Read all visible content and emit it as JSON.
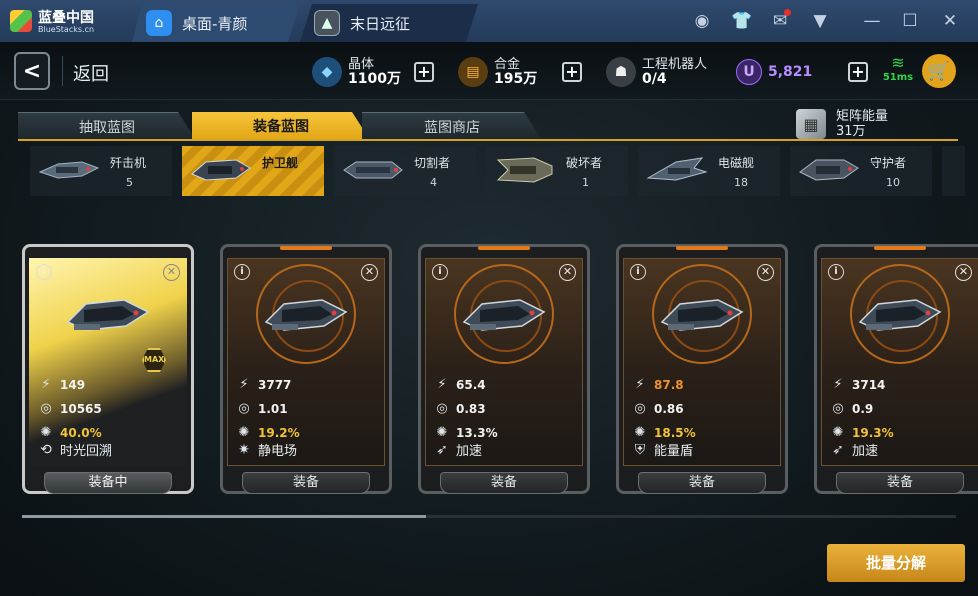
{
  "titlebar": {
    "brand": "蓝叠中国",
    "brand_sub": "BlueStacks.cn",
    "tabs": [
      {
        "label": "桌面-青颜",
        "icon": "home-icon"
      },
      {
        "label": "末日远征",
        "icon": "game-icon"
      }
    ],
    "controls": [
      "account-icon",
      "tshirt-icon",
      "mail-icon",
      "menu-icon",
      "minimize-icon",
      "maximize-icon",
      "close-icon"
    ]
  },
  "topbar": {
    "back_label": "返回",
    "resources": [
      {
        "name": "晶体",
        "value": "1100万",
        "icon": "crystal-icon",
        "color": "#2f8fe0"
      },
      {
        "name": "合金",
        "value": "195万",
        "icon": "alloy-icon",
        "color": "#e59a17"
      },
      {
        "name": "工程机器人",
        "value": "0/4",
        "icon": "robot-icon",
        "color": "#dcdcdc"
      }
    ],
    "u_currency": {
      "symbol": "U",
      "value": "5,821",
      "color": "#9b6bff"
    },
    "ping": "51ms"
  },
  "category_tabs": [
    {
      "label": "抽取蓝图",
      "active": false
    },
    {
      "label": "装备蓝图",
      "active": true
    },
    {
      "label": "蓝图商店",
      "active": false
    }
  ],
  "matrix_energy": {
    "label": "矩阵能量",
    "value": "31万"
  },
  "ship_types": [
    {
      "name": "歼击机",
      "count": "5",
      "active": false
    },
    {
      "name": "护卫舰",
      "count": "",
      "active": true
    },
    {
      "name": "切割者",
      "count": "4",
      "active": false
    },
    {
      "name": "破坏者",
      "count": "1",
      "active": false
    },
    {
      "name": "电磁舰",
      "count": "18",
      "active": false
    },
    {
      "name": "守护者",
      "count": "10",
      "active": false
    }
  ],
  "cards": [
    {
      "stats": [
        "149",
        "10565",
        "40.0%"
      ],
      "stat_colors": [
        "white",
        "white",
        "gold"
      ],
      "skill": "时光回溯",
      "button": "装备中",
      "equipped": true,
      "max_badge": "MAX"
    },
    {
      "stats": [
        "3777",
        "1.01",
        "19.2%"
      ],
      "stat_colors": [
        "white",
        "white",
        "gold"
      ],
      "skill": "静电场",
      "button": "装备",
      "equipped": false
    },
    {
      "stats": [
        "65.4",
        "0.83",
        "13.3%"
      ],
      "stat_colors": [
        "white",
        "white",
        "white"
      ],
      "skill": "加速",
      "button": "装备",
      "equipped": false
    },
    {
      "stats": [
        "87.8",
        "0.86",
        "18.5%"
      ],
      "stat_colors": [
        "orange",
        "white",
        "gold"
      ],
      "skill": "能量盾",
      "button": "装备",
      "equipped": false
    },
    {
      "stats": [
        "3714",
        "0.9",
        "19.3%"
      ],
      "stat_colors": [
        "white",
        "white",
        "gold"
      ],
      "skill": "加速",
      "button": "装备",
      "equipped": false
    }
  ],
  "batch_button": "批量分解"
}
